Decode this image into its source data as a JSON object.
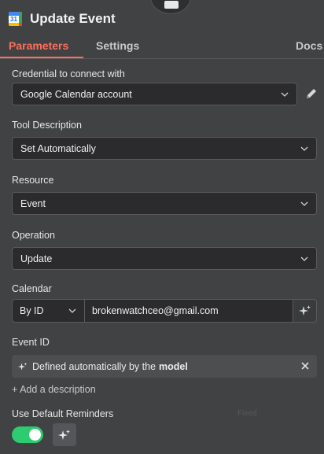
{
  "header": {
    "title": "Update Event",
    "app_icon": "google-calendar-icon",
    "app_icon_number": "31"
  },
  "tabs": [
    {
      "label": "Parameters",
      "active": true
    },
    {
      "label": "Settings",
      "active": false
    },
    {
      "label": "Docs",
      "active": false
    }
  ],
  "credential": {
    "label": "Credential to connect with",
    "value": "Google Calendar account",
    "edit_icon": "pencil-icon"
  },
  "tool_description": {
    "label": "Tool Description",
    "value": "Set Automatically"
  },
  "resource": {
    "label": "Resource",
    "value": "Event"
  },
  "operation": {
    "label": "Operation",
    "value": "Update"
  },
  "calendar": {
    "label": "Calendar",
    "mode": "By ID",
    "value": "brokenwatchceo@gmail.com",
    "ai_icon": "sparkles-icon"
  },
  "event_id": {
    "label": "Event ID",
    "value_prefix": "Defined automatically by the",
    "value_bold": "model",
    "clear_icon": "close-icon"
  },
  "add_description": "+ Add a description",
  "use_default_reminders": {
    "label": "Use Default Reminders",
    "enabled": true,
    "faded_text": "Fixed"
  },
  "colors": {
    "background": "#414244",
    "accent": "#ff6d5a",
    "toggle_on": "#2ecc71",
    "input_bg": "#2b2b2d"
  }
}
